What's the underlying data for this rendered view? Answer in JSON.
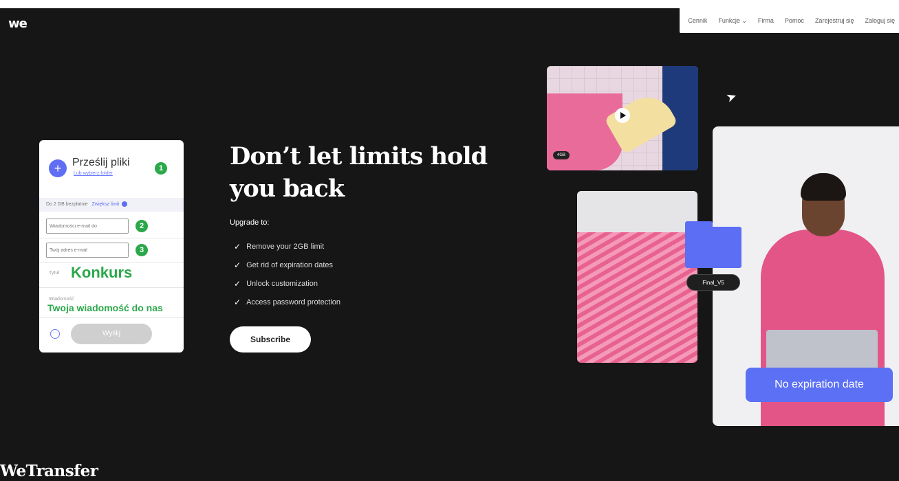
{
  "brand": {
    "logo": "we",
    "footer_logo": "WeTransfer"
  },
  "nav": {
    "items": [
      "Cennik",
      "Funkcje ⌄",
      "Firma",
      "Pomoc",
      "Zarejestruj się",
      "Zaloguj się"
    ]
  },
  "upload": {
    "title": "Prześlij pliki",
    "subtitle": "Lub wybierz folder",
    "limit_text": "Do 2 GB bezpłatnie",
    "limit_link": "Zwiększ limit",
    "email_to_placeholder": "Wiadomości e-mail do",
    "your_email_placeholder": "Twój adres e-mail",
    "title_label": "Tytuł",
    "title_value": "Konkurs",
    "message_label": "Wiadomość",
    "message_value": "Twoja wiadomość do nas",
    "send_label": "Wyślij",
    "more_label": "···",
    "steps": [
      "1",
      "2",
      "3"
    ]
  },
  "promo": {
    "headline": "Don’t let limits hold you back",
    "upgrade_label": "Upgrade to:",
    "features": [
      "Remove your 2GB limit",
      "Get rid of expiration dates",
      "Unlock customization",
      "Access password protection"
    ],
    "subscribe_label": "Subscribe"
  },
  "visuals": {
    "video_badge": "4GB",
    "folder_name": "Final_V5",
    "expiration_text": "No expiration date"
  }
}
